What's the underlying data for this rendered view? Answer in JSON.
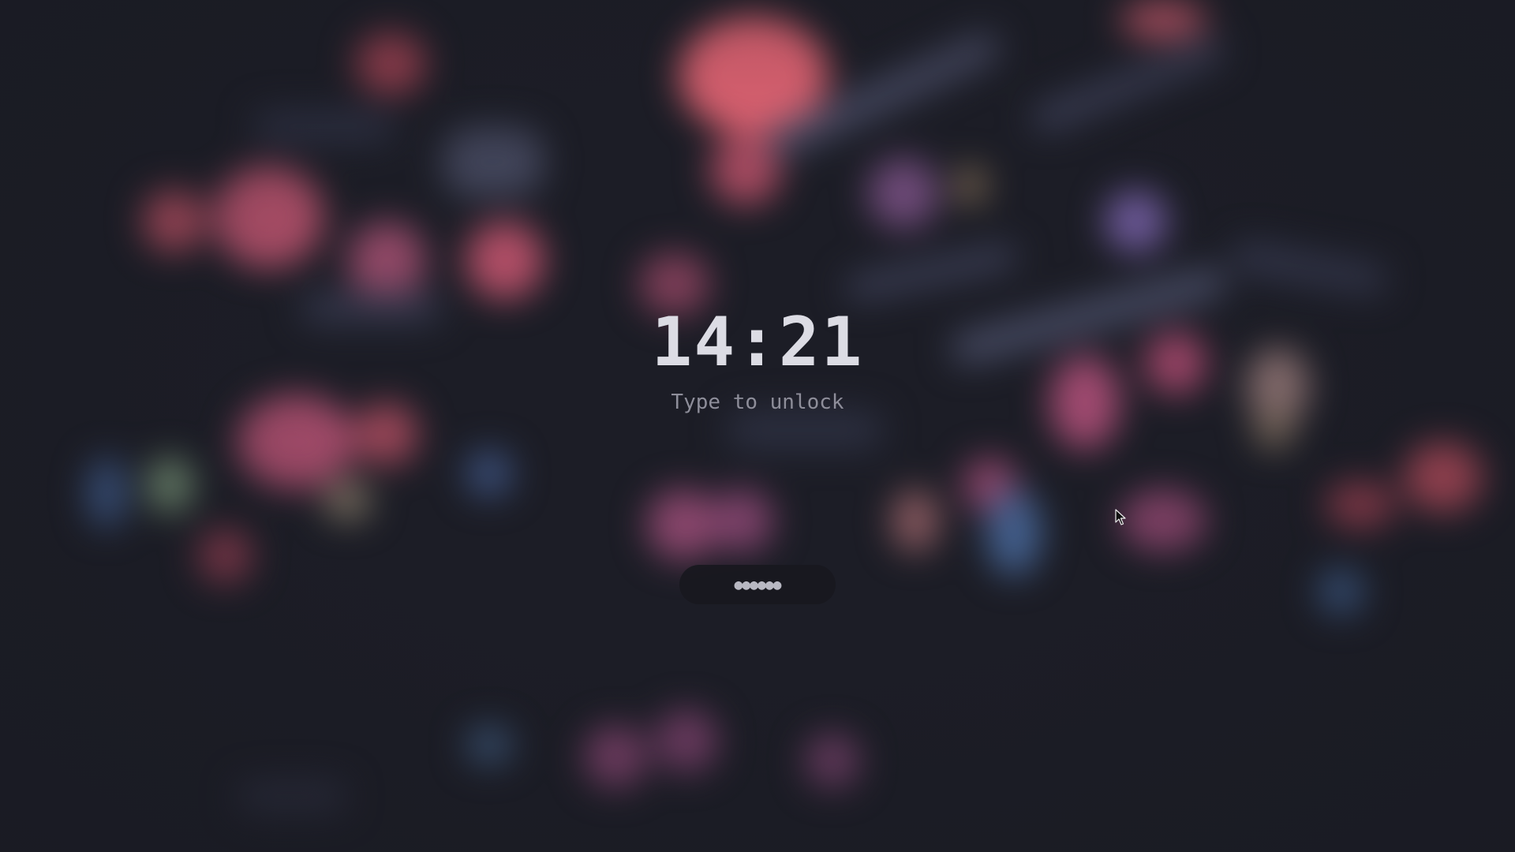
{
  "lock_screen": {
    "time": "14:21",
    "hint": "Type to unlock",
    "password_mask": "●●●●●●"
  },
  "icons": {
    "cursor": "mouse-pointer-icon"
  },
  "colors": {
    "background": "#1c1d26",
    "clock_text": "#dcdce4",
    "hint_text": "#8e8e9a",
    "pill_background": "#18181e",
    "accent_pink": "#e0607a"
  }
}
